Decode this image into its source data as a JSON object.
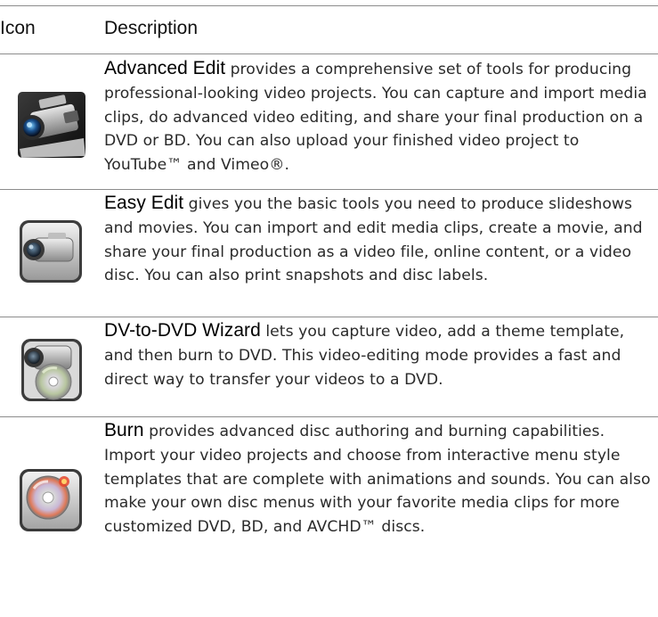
{
  "header": {
    "icon_label": "Icon",
    "description_label": "Description"
  },
  "rows": [
    {
      "icon": "video-camera-icon",
      "term": "Advanced Edit",
      "text": " provides a comprehensive set of tools for producing professional-looking video projects. You can capture and import media clips, do advanced video editing, and share your final production on a DVD or BD. You can also upload your finished video project to YouTube™ and Vimeo®."
    },
    {
      "icon": "camcorder-icon",
      "term": "Easy Edit",
      "text": " gives you the basic tools you need to produce slideshows and movies. You can import and edit media clips, create a movie, and share your final production as a video file, online content, or a video disc. You can also print snapshots and disc labels."
    },
    {
      "icon": "camcorder-disc-icon",
      "term": "DV-to-DVD Wizard",
      "text": " lets you capture video, add a theme template, and then burn to DVD. This video-editing mode provides a fast and direct way to transfer your videos to a DVD."
    },
    {
      "icon": "disc-burn-icon",
      "term": "Burn",
      "text": " provides advanced disc authoring and burning capabilities. Import your video projects and choose from interactive menu style templates that are complete with animations and sounds. You can also make your own disc menus with your favorite media clips for more customized DVD, BD, and AVCHD™ discs."
    }
  ]
}
